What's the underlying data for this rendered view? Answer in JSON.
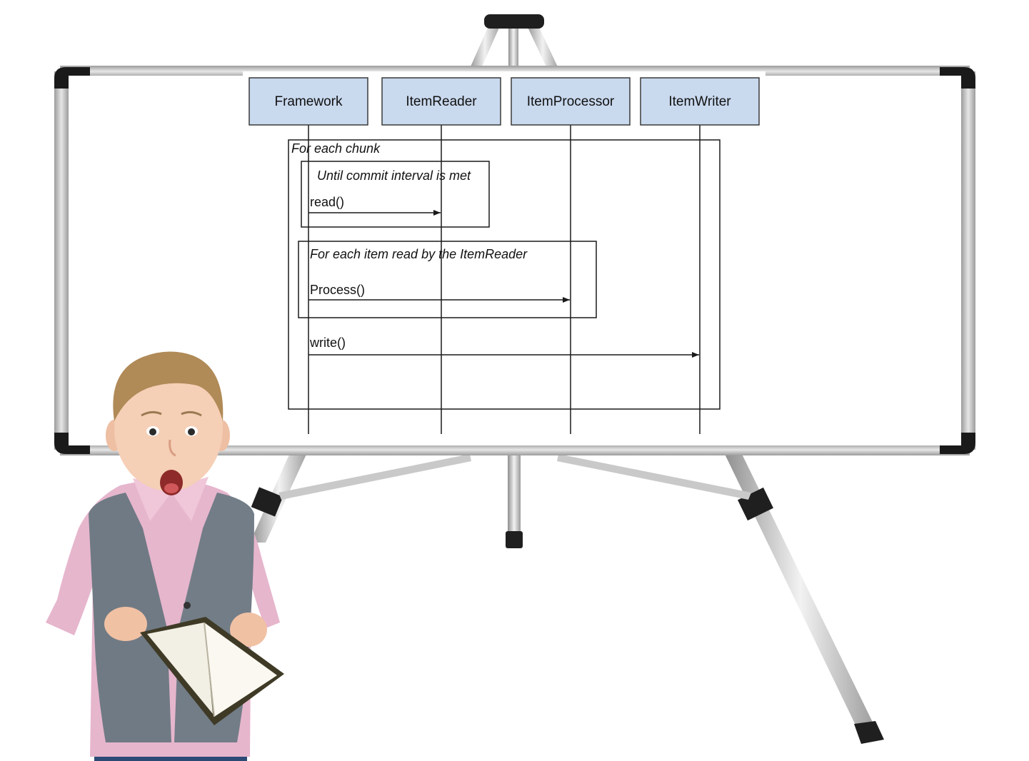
{
  "diagram": {
    "type": "sequence",
    "lifelines": [
      {
        "id": "framework",
        "label": "Framework"
      },
      {
        "id": "itemreader",
        "label": "ItemReader"
      },
      {
        "id": "itemprocessor",
        "label": "ItemProcessor"
      },
      {
        "id": "itemwriter",
        "label": "ItemWriter"
      }
    ],
    "frames": [
      {
        "id": "chunk",
        "label": "For each chunk"
      },
      {
        "id": "commit",
        "label": "Until commit interval is met"
      },
      {
        "id": "process-loop",
        "label": "For each item read by the ItemReader"
      }
    ],
    "messages": [
      {
        "id": "read",
        "label": "read()",
        "from": "framework",
        "to": "itemreader"
      },
      {
        "id": "process",
        "label": "Process()",
        "from": "framework",
        "to": "itemprocessor"
      },
      {
        "id": "write",
        "label": "write()",
        "from": "framework",
        "to": "itemwriter"
      }
    ],
    "colors": {
      "lifeline_box_fill": "#c9d9ee",
      "lifeline_box_stroke": "#3a3a3a",
      "line": "#1a1a1a",
      "board_frame": "#c4c4c4",
      "board_corner": "#1a1a1a",
      "board_surface": "#ffffff",
      "easel": "#cfcfcf"
    }
  },
  "scene": {
    "illustration": "child-with-book"
  }
}
